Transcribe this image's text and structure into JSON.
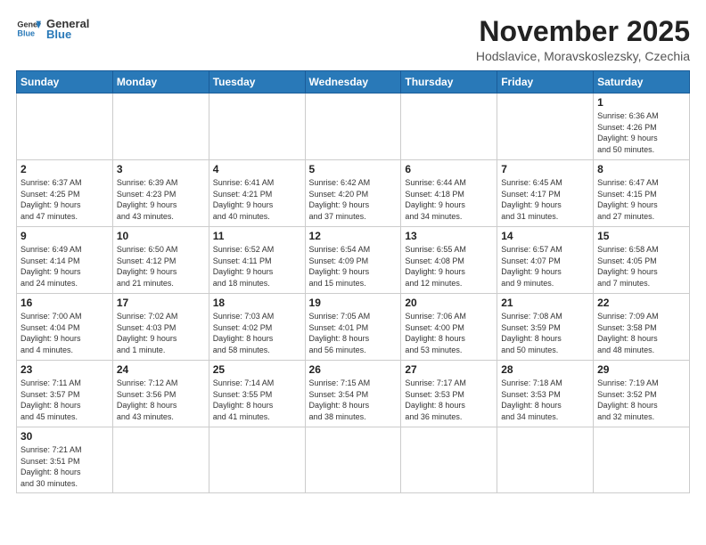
{
  "logo": {
    "line1": "General",
    "line2": "Blue"
  },
  "title": "November 2025",
  "subtitle": "Hodslavice, Moravskoslezsky, Czechia",
  "weekdays": [
    "Sunday",
    "Monday",
    "Tuesday",
    "Wednesday",
    "Thursday",
    "Friday",
    "Saturday"
  ],
  "weeks": [
    [
      {
        "day": "",
        "info": ""
      },
      {
        "day": "",
        "info": ""
      },
      {
        "day": "",
        "info": ""
      },
      {
        "day": "",
        "info": ""
      },
      {
        "day": "",
        "info": ""
      },
      {
        "day": "",
        "info": ""
      },
      {
        "day": "1",
        "info": "Sunrise: 6:36 AM\nSunset: 4:26 PM\nDaylight: 9 hours\nand 50 minutes."
      }
    ],
    [
      {
        "day": "2",
        "info": "Sunrise: 6:37 AM\nSunset: 4:25 PM\nDaylight: 9 hours\nand 47 minutes."
      },
      {
        "day": "3",
        "info": "Sunrise: 6:39 AM\nSunset: 4:23 PM\nDaylight: 9 hours\nand 43 minutes."
      },
      {
        "day": "4",
        "info": "Sunrise: 6:41 AM\nSunset: 4:21 PM\nDaylight: 9 hours\nand 40 minutes."
      },
      {
        "day": "5",
        "info": "Sunrise: 6:42 AM\nSunset: 4:20 PM\nDaylight: 9 hours\nand 37 minutes."
      },
      {
        "day": "6",
        "info": "Sunrise: 6:44 AM\nSunset: 4:18 PM\nDaylight: 9 hours\nand 34 minutes."
      },
      {
        "day": "7",
        "info": "Sunrise: 6:45 AM\nSunset: 4:17 PM\nDaylight: 9 hours\nand 31 minutes."
      },
      {
        "day": "8",
        "info": "Sunrise: 6:47 AM\nSunset: 4:15 PM\nDaylight: 9 hours\nand 27 minutes."
      }
    ],
    [
      {
        "day": "9",
        "info": "Sunrise: 6:49 AM\nSunset: 4:14 PM\nDaylight: 9 hours\nand 24 minutes."
      },
      {
        "day": "10",
        "info": "Sunrise: 6:50 AM\nSunset: 4:12 PM\nDaylight: 9 hours\nand 21 minutes."
      },
      {
        "day": "11",
        "info": "Sunrise: 6:52 AM\nSunset: 4:11 PM\nDaylight: 9 hours\nand 18 minutes."
      },
      {
        "day": "12",
        "info": "Sunrise: 6:54 AM\nSunset: 4:09 PM\nDaylight: 9 hours\nand 15 minutes."
      },
      {
        "day": "13",
        "info": "Sunrise: 6:55 AM\nSunset: 4:08 PM\nDaylight: 9 hours\nand 12 minutes."
      },
      {
        "day": "14",
        "info": "Sunrise: 6:57 AM\nSunset: 4:07 PM\nDaylight: 9 hours\nand 9 minutes."
      },
      {
        "day": "15",
        "info": "Sunrise: 6:58 AM\nSunset: 4:05 PM\nDaylight: 9 hours\nand 7 minutes."
      }
    ],
    [
      {
        "day": "16",
        "info": "Sunrise: 7:00 AM\nSunset: 4:04 PM\nDaylight: 9 hours\nand 4 minutes."
      },
      {
        "day": "17",
        "info": "Sunrise: 7:02 AM\nSunset: 4:03 PM\nDaylight: 9 hours\nand 1 minute."
      },
      {
        "day": "18",
        "info": "Sunrise: 7:03 AM\nSunset: 4:02 PM\nDaylight: 8 hours\nand 58 minutes."
      },
      {
        "day": "19",
        "info": "Sunrise: 7:05 AM\nSunset: 4:01 PM\nDaylight: 8 hours\nand 56 minutes."
      },
      {
        "day": "20",
        "info": "Sunrise: 7:06 AM\nSunset: 4:00 PM\nDaylight: 8 hours\nand 53 minutes."
      },
      {
        "day": "21",
        "info": "Sunrise: 7:08 AM\nSunset: 3:59 PM\nDaylight: 8 hours\nand 50 minutes."
      },
      {
        "day": "22",
        "info": "Sunrise: 7:09 AM\nSunset: 3:58 PM\nDaylight: 8 hours\nand 48 minutes."
      }
    ],
    [
      {
        "day": "23",
        "info": "Sunrise: 7:11 AM\nSunset: 3:57 PM\nDaylight: 8 hours\nand 45 minutes."
      },
      {
        "day": "24",
        "info": "Sunrise: 7:12 AM\nSunset: 3:56 PM\nDaylight: 8 hours\nand 43 minutes."
      },
      {
        "day": "25",
        "info": "Sunrise: 7:14 AM\nSunset: 3:55 PM\nDaylight: 8 hours\nand 41 minutes."
      },
      {
        "day": "26",
        "info": "Sunrise: 7:15 AM\nSunset: 3:54 PM\nDaylight: 8 hours\nand 38 minutes."
      },
      {
        "day": "27",
        "info": "Sunrise: 7:17 AM\nSunset: 3:53 PM\nDaylight: 8 hours\nand 36 minutes."
      },
      {
        "day": "28",
        "info": "Sunrise: 7:18 AM\nSunset: 3:53 PM\nDaylight: 8 hours\nand 34 minutes."
      },
      {
        "day": "29",
        "info": "Sunrise: 7:19 AM\nSunset: 3:52 PM\nDaylight: 8 hours\nand 32 minutes."
      }
    ],
    [
      {
        "day": "30",
        "info": "Sunrise: 7:21 AM\nSunset: 3:51 PM\nDaylight: 8 hours\nand 30 minutes."
      },
      {
        "day": "",
        "info": ""
      },
      {
        "day": "",
        "info": ""
      },
      {
        "day": "",
        "info": ""
      },
      {
        "day": "",
        "info": ""
      },
      {
        "day": "",
        "info": ""
      },
      {
        "day": "",
        "info": ""
      }
    ]
  ]
}
